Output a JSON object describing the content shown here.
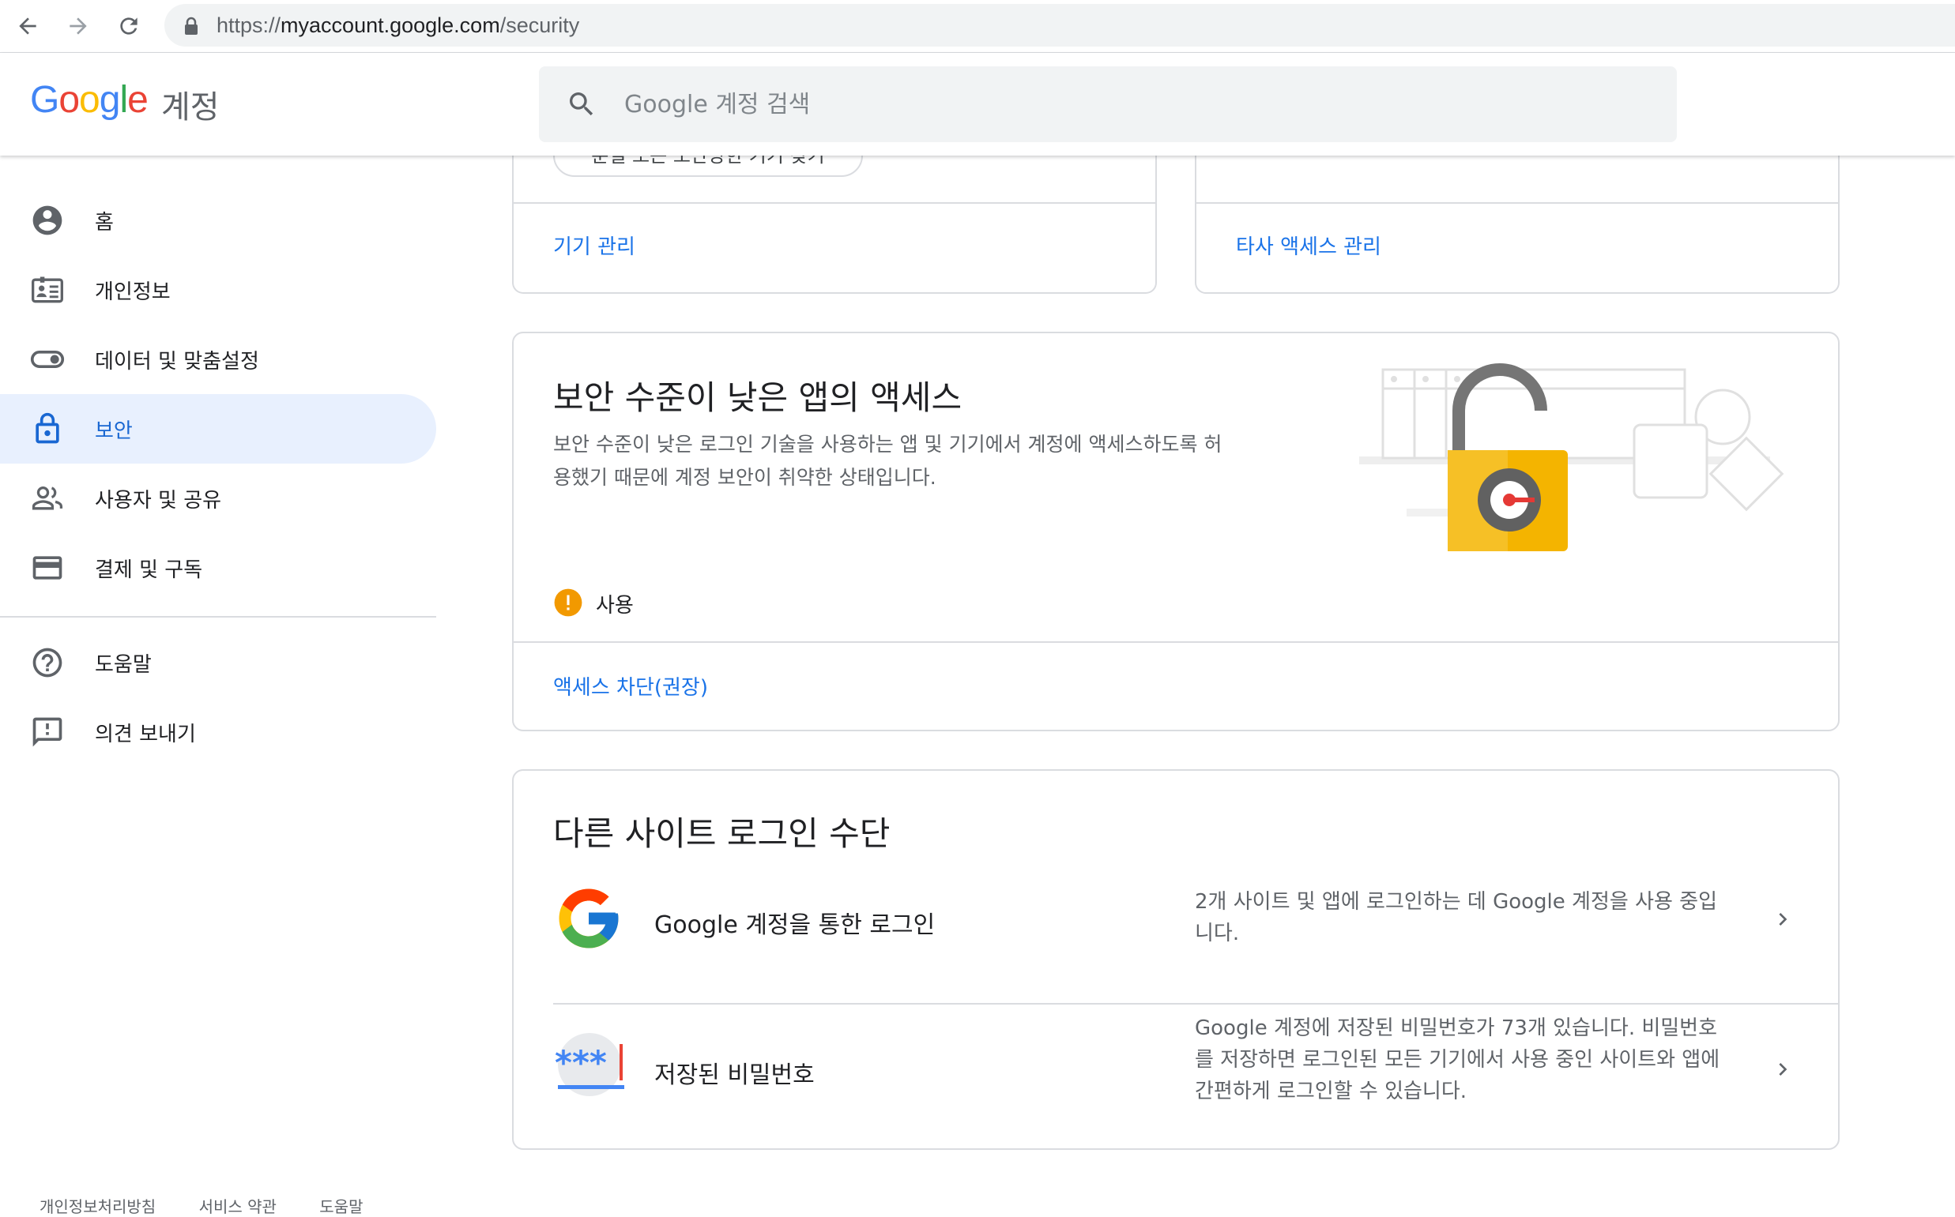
{
  "browser": {
    "url_scheme": "https://",
    "url_host": "myaccount.google.com",
    "url_path": "/security"
  },
  "header": {
    "logo_text": "Google",
    "product": "계정",
    "search_placeholder": "Google 계정 검색"
  },
  "sidebar": {
    "items": [
      {
        "label": "홈",
        "icon": "account-circle-icon"
      },
      {
        "label": "개인정보",
        "icon": "id-card-icon"
      },
      {
        "label": "데이터 및 맞춤설정",
        "icon": "toggle-icon"
      },
      {
        "label": "보안",
        "icon": "lock-icon",
        "active": true
      },
      {
        "label": "사용자 및 공유",
        "icon": "people-icon"
      },
      {
        "label": "결제 및 구독",
        "icon": "credit-card-icon"
      }
    ],
    "secondary": [
      {
        "label": "도움말",
        "icon": "help-icon"
      },
      {
        "label": "의견 보내기",
        "icon": "feedback-icon"
      }
    ]
  },
  "top_cards": {
    "partial_button": "분실 또는 도난당한 기기 찾기",
    "left_link": "기기 관리",
    "right_link": "타사 액세스 관리"
  },
  "less_secure": {
    "title": "보안 수준이 낮은 앱의 액세스",
    "description_line1": "보안 수준이 낮은 로그인 기술을 사용하는 앱 및 기기에서 계정에 액세스하도록 허",
    "description_line2": "용했기 때문에 계정 보안이 취약한 상태입니다.",
    "status": "사용",
    "status_color": "#f29900",
    "action_link": "액세스 차단(권장)"
  },
  "other_signin": {
    "title": "다른 사이트 로그인 수단",
    "rows": [
      {
        "title": "Google 계정을 통한 로그인",
        "desc_line1": "2개 사이트 및 앱에 로그인하는 데 Google 계정을 사용 중입",
        "desc_line2": "니다."
      },
      {
        "title": "저장된 비밀번호",
        "desc_line1": "Google 계정에 저장된 비밀번호가 73개 있습니다. 비밀번호",
        "desc_line2": "를 저장하면 로그인된 모든 기기에서 사용 중인 사이트와 앱에",
        "desc_line3": "간편하게 로그인할 수 있습니다."
      }
    ]
  },
  "footer": {
    "links": [
      "개인정보처리방침",
      "서비스 약관",
      "도움말"
    ]
  },
  "colors": {
    "accent": "#1a73e8",
    "active_bg": "#e8f0fe"
  }
}
